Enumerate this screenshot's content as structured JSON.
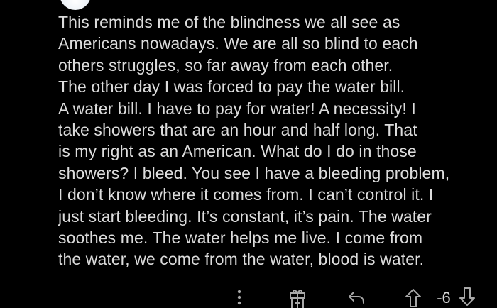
{
  "comment": {
    "lines": [
      "This reminds me of the blindness we all see as",
      "Americans nowadays. We are all so blind to each",
      "others struggles, so far away from each other.",
      "The other day I was forced to pay the water bill.",
      "A water bill. I have to pay for water! A necessity! I",
      "take showers that are an hour and half long. That",
      "is my right as an American. What do I do in those",
      "showers? I bleed. You see I have a bleeding problem,",
      "I don’t know where it comes from. I can’t control it. I",
      "just start bleeding. It’s constant, it’s pain. The water",
      "soothes me. The water helps me live. I come from",
      "the water, we come from the water, blood is water."
    ]
  },
  "actions": {
    "more_icon": "more-vertical-icon",
    "award_icon": "gift-icon",
    "reply_icon": "reply-arrow-icon",
    "upvote_icon": "arrow-up-icon",
    "downvote_icon": "arrow-down-icon",
    "score": "-6"
  },
  "colors": {
    "background": "#000000",
    "text": "#dcdcdc",
    "icon": "#a8a8a8"
  }
}
